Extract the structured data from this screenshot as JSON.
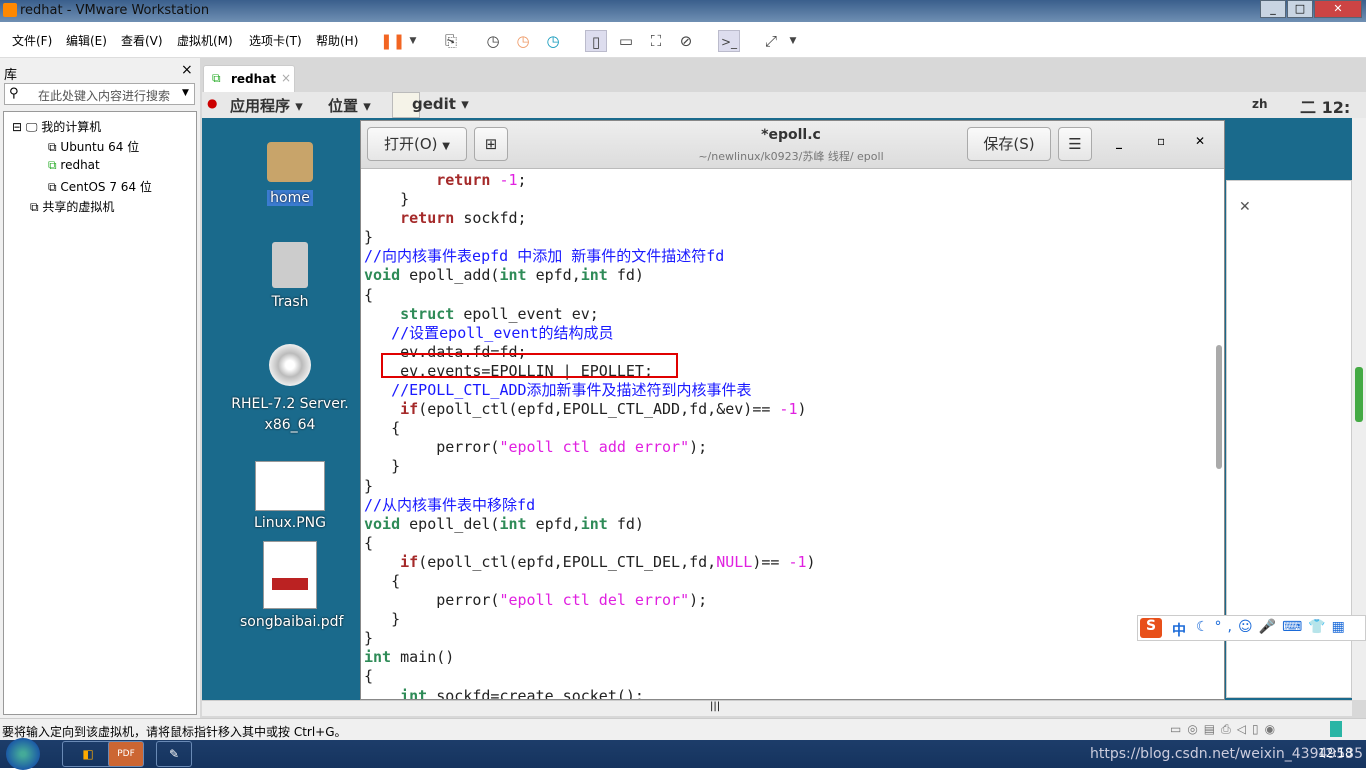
{
  "window": {
    "title": "redhat - VMware Workstation"
  },
  "menu": [
    "文件(F)",
    "编辑(E)",
    "查看(V)",
    "虚拟机(M)",
    "选项卡(T)",
    "帮助(H)"
  ],
  "library": {
    "title": "库",
    "close": "×",
    "search_placeholder": "在此处键入内容进行搜索",
    "tree": [
      {
        "label": "我的计算机",
        "level": 0
      },
      {
        "label": "Ubuntu 64 位",
        "level": 1
      },
      {
        "label": "redhat",
        "level": 1
      },
      {
        "label": "CentOS 7 64 位",
        "level": 1
      },
      {
        "label": "共享的虚拟机",
        "level": 0
      }
    ]
  },
  "tab": {
    "label": "redhat",
    "close": "×"
  },
  "gnome": {
    "apps": "应用程序",
    "places": "位置",
    "gedit": "gedit",
    "lang": "zh",
    "clock": "二 12:"
  },
  "desktop": {
    "icons": [
      "home",
      "Trash",
      "RHEL-7.2 Server.\nx86_64",
      "Linux.PNG",
      "songbaibai.pdf"
    ]
  },
  "gedit": {
    "open": "打开(O)",
    "title": "*epoll.c",
    "path": "~/newlinux/k0923/苏峰 线程/ epoll",
    "save": "保存(S)"
  },
  "code": [
    [
      [
        "",
        "        "
      ],
      [
        "kw",
        "return"
      ],
      [
        "",
        " "
      ],
      [
        "nm",
        "-1"
      ],
      [
        "",
        ";"
      ]
    ],
    [
      [
        "",
        "    }"
      ]
    ],
    [
      [
        "",
        "    "
      ],
      [
        "kw",
        "return"
      ],
      [
        "",
        " sockfd;"
      ]
    ],
    [
      [
        "",
        "}"
      ]
    ],
    [
      [
        "cm",
        "//向内核事件表epfd 中添加 新事件的文件描述符fd"
      ]
    ],
    [
      [
        "ty",
        "void"
      ],
      [
        "",
        " epoll_add("
      ],
      [
        "ty",
        "int"
      ],
      [
        "",
        " epfd,"
      ],
      [
        "ty",
        "int"
      ],
      [
        "",
        " fd)"
      ]
    ],
    [
      [
        "",
        "{"
      ]
    ],
    [
      [
        "",
        "    "
      ],
      [
        "ty",
        "struct"
      ],
      [
        "",
        " epoll_event ev;"
      ]
    ],
    [
      [
        "",
        "   "
      ],
      [
        "cm",
        "//设置epoll_event的结构成员"
      ]
    ],
    [
      [
        "",
        "    ev.data.fd=fd;"
      ]
    ],
    [
      [
        "",
        "    ev.events=EPOLLIN | EPOLLET;"
      ]
    ],
    [
      [
        "",
        "   "
      ],
      [
        "cm",
        "//EPOLL_CTL_ADD添加新事件及描述符到内核事件表"
      ]
    ],
    [
      [
        "",
        "    "
      ],
      [
        "kw",
        "if"
      ],
      [
        "",
        "(epoll_ctl(epfd,EPOLL_CTL_ADD,fd,&ev)== "
      ],
      [
        "nm",
        "-1"
      ],
      [
        "",
        ")"
      ]
    ],
    [
      [
        "",
        "   {"
      ]
    ],
    [
      [
        "",
        "        perror("
      ],
      [
        "st",
        "\"epoll ctl add error\""
      ],
      [
        "",
        ");"
      ]
    ],
    [
      [
        "",
        "   }"
      ]
    ],
    [
      [
        "",
        "}"
      ]
    ],
    [
      [
        "cm",
        "//从内核事件表中移除fd"
      ]
    ],
    [
      [
        "ty",
        "void"
      ],
      [
        "",
        " epoll_del("
      ],
      [
        "ty",
        "int"
      ],
      [
        "",
        " epfd,"
      ],
      [
        "ty",
        "int"
      ],
      [
        "",
        " fd)"
      ]
    ],
    [
      [
        "",
        "{"
      ]
    ],
    [
      [
        "",
        "    "
      ],
      [
        "kw",
        "if"
      ],
      [
        "",
        "(epoll_ctl(epfd,EPOLL_CTL_DEL,fd,"
      ],
      [
        "nm",
        "NULL"
      ],
      [
        "",
        ")== "
      ],
      [
        "nm",
        "-1"
      ],
      [
        "",
        ")"
      ]
    ],
    [
      [
        "",
        "   {"
      ]
    ],
    [
      [
        "",
        "        perror("
      ],
      [
        "st",
        "\"epoll ctl del error\""
      ],
      [
        "",
        ");"
      ]
    ],
    [
      [
        "",
        "   }"
      ]
    ],
    [
      [
        "",
        "}"
      ]
    ],
    [
      [
        "ty",
        "int"
      ],
      [
        "",
        " main()"
      ]
    ],
    [
      [
        "",
        "{"
      ]
    ],
    [
      [
        "",
        "    "
      ],
      [
        "ty",
        "int"
      ],
      [
        "",
        " sockfd=create_socket();"
      ]
    ]
  ],
  "status": {
    "message": "要将输入定向到该虚拟机，请将鼠标指针移入其中或按 Ctrl+G。"
  },
  "taskbar": {
    "watermark": "https://blog.csdn.net/weixin_43949535",
    "clock": "12:18"
  },
  "ime": {
    "label": "中"
  },
  "colors": {
    "highlight_box": "#e00000",
    "pause": "#f26522",
    "desktop": "#1a6a8c"
  }
}
